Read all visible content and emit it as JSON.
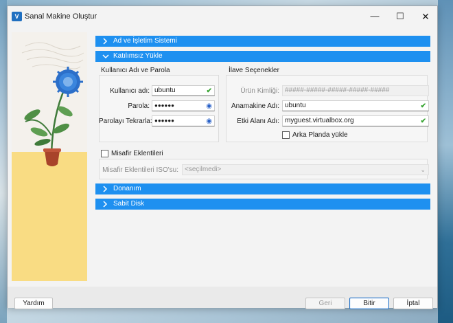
{
  "window": {
    "title": "Sanal Makine Oluştur",
    "app_icon": "virtualbox-logo-icon",
    "controls": {
      "minimize": "—",
      "maximize": "☐",
      "close": "✕"
    }
  },
  "sections": {
    "name_os": {
      "label": "Ad ve İşletim Sistemi",
      "expanded": false
    },
    "unattended": {
      "label": "Katılımsız Yükle",
      "expanded": true
    },
    "hardware": {
      "label": "Donanım",
      "expanded": false
    },
    "hard_disk": {
      "label": "Sabit Disk",
      "expanded": false
    }
  },
  "user_group": {
    "title": "Kullanıcı Adı ve Parola",
    "username_label": "Kullanıcı adı:",
    "username_value": "ubuntu",
    "password_label": "Parola:",
    "password_value": "●●●●●●",
    "password_repeat_label": "Parolayı Tekrarla:",
    "password_repeat_value": "●●●●●●"
  },
  "extra_group": {
    "title": "İlave Seçenekler",
    "product_key_label": "Ürün Kimliği:",
    "product_key_placeholder": "#####-#####-#####-#####-#####",
    "hostname_label": "Anamakine Adı:",
    "hostname_value": "ubuntu",
    "domain_label": "Etki Alanı Adı:",
    "domain_value": "myguest.virtualbox.org",
    "background_install_label": "Arka Planda yükle",
    "background_install_checked": false
  },
  "guest_additions": {
    "label": "Misafir Eklentileri",
    "checked": false,
    "iso_label": "Misafir Eklentileri ISO'su:",
    "iso_value": "<seçilmedi>"
  },
  "buttons": {
    "help": "Yardım",
    "back": "Geri",
    "finish": "Bitir",
    "cancel": "İptal"
  },
  "icons": {
    "valid": "✔",
    "reveal": "◉",
    "expand": "chevron-right-icon",
    "collapse": "chevron-down-icon"
  },
  "colors": {
    "section_header": "#1e90f0",
    "valid_check": "#3aa534",
    "default_button_border": "#1e6fc6"
  }
}
